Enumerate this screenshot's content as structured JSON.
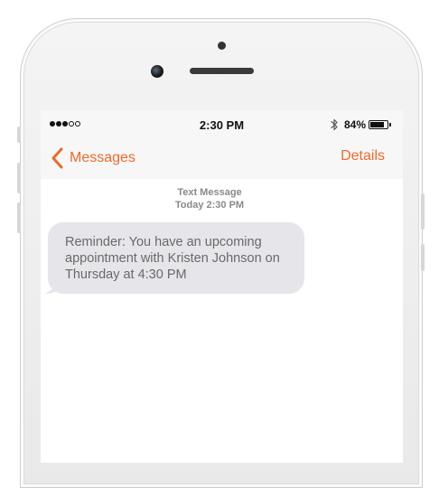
{
  "status_bar": {
    "signal": [
      "on",
      "on",
      "on",
      "off",
      "off"
    ],
    "time": "2:30 PM",
    "bluetooth_icon": "bluetooth-icon",
    "battery_percent": "84%",
    "battery_level": 0.84
  },
  "nav": {
    "back_icon": "chevron-left-icon",
    "back_label": "Messages",
    "details_label": "Details",
    "accent_color": "#ee6a2a"
  },
  "conversation": {
    "meta_type": "Text Message",
    "meta_time": "Today 2:30 PM",
    "messages": [
      {
        "direction": "incoming",
        "text": "Reminder: You have an upcoming appointment with Kristen Johnson on Thursday at 4:30 PM"
      }
    ]
  },
  "colors": {
    "bubble_incoming": "#e5e5ea",
    "bar_background": "#f7f7f7"
  }
}
